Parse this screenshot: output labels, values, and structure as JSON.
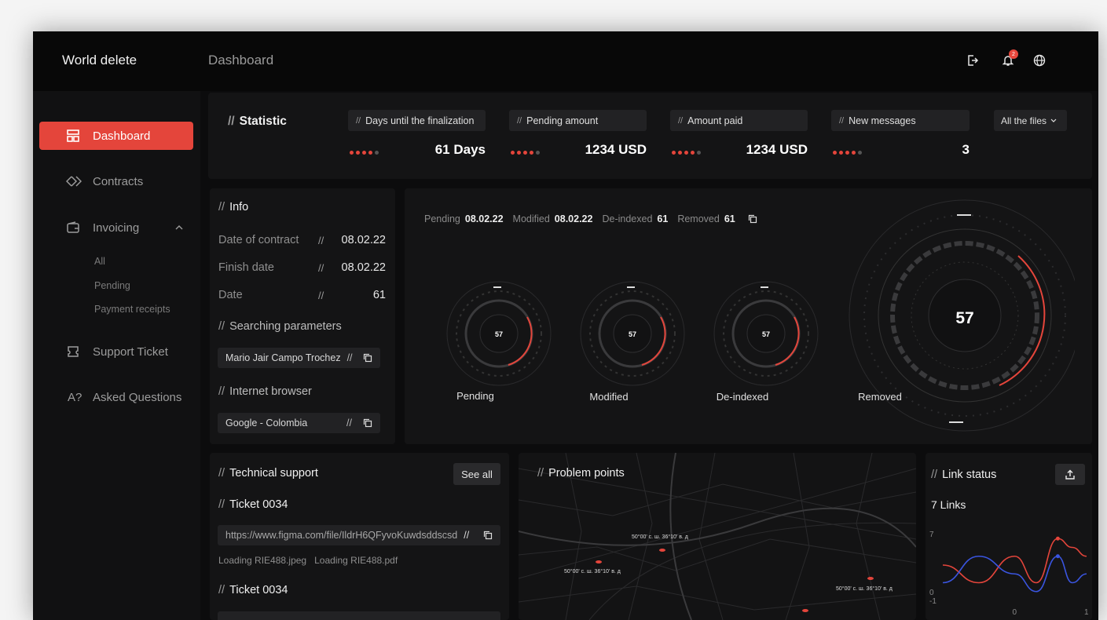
{
  "header": {
    "brand": "World delete",
    "page_title": "Dashboard",
    "notification_count": "2"
  },
  "sidebar": {
    "items": [
      {
        "label": "Dashboard",
        "icon": "dashboard-icon"
      },
      {
        "label": "Contracts",
        "icon": "contracts-icon"
      },
      {
        "label": "Invoicing",
        "icon": "wallet-icon"
      },
      {
        "label": "Support Ticket",
        "icon": "ticket-icon"
      },
      {
        "label": "Asked Questions",
        "icon": "question-icon"
      }
    ],
    "invoicing_sub": [
      "All",
      "Pending",
      "Payment receipts"
    ]
  },
  "statistic": {
    "title": "Statistic",
    "filter_label": "All the files",
    "cards": [
      {
        "label": "Days until the finalization",
        "value": "61 Days"
      },
      {
        "label": "Pending amount",
        "value": "1234 USD"
      },
      {
        "label": "Amount paid",
        "value": "1234 USD"
      },
      {
        "label": "New messages",
        "value": "3"
      }
    ]
  },
  "info": {
    "title": "Info",
    "rows": [
      {
        "label": "Date of contract",
        "value": "08.02.22"
      },
      {
        "label": "Finish date",
        "value": "08.02.22"
      },
      {
        "label": "Date",
        "value": "61"
      }
    ],
    "search_title": "Searching parameters",
    "search_value": "Mario Jair Campo Trochez",
    "browser_title": "Internet browser",
    "browser_value": "Google - Colombia"
  },
  "summary": {
    "pending_label": "Pending",
    "pending_value": "08.02.22",
    "modified_label": "Modified",
    "modified_value": "08.02.22",
    "deindexed_label": "De-indexed",
    "deindexed_value": "61",
    "removed_label": "Removed",
    "removed_value": "61"
  },
  "gauges": [
    {
      "label": "Pending",
      "value": "57"
    },
    {
      "label": "Modified",
      "value": "57"
    },
    {
      "label": "De-indexed",
      "value": "57"
    },
    {
      "label": "Removed",
      "value": "57"
    }
  ],
  "support": {
    "title": "Technical support",
    "see_all": "See all",
    "ticket1": "Ticket 0034",
    "url": "https://www.figma.com/file/IldrH6QFyvoKuwdsddscsd",
    "file1": "Loading RIE488.jpeg",
    "file2": "Loading RIE488.pdf",
    "ticket2": "Ticket 0034"
  },
  "map": {
    "title": "Problem points",
    "coords": [
      "50°00' с. ш. 36°10' в. д",
      "50°00' с. ш. 36°10' в. д",
      "50°00' с. ш. 36°10' в. д"
    ]
  },
  "links": {
    "title": "Link status",
    "count": "7 Links",
    "y_ticks": [
      "7",
      "0",
      "-1"
    ],
    "x_ticks": [
      "0",
      "1"
    ]
  },
  "chart_data": {
    "type": "line",
    "title": "Link status",
    "x": [
      -1.0,
      -0.5,
      0.0,
      0.3,
      0.6,
      0.8,
      1.0
    ],
    "ylim": [
      -1,
      7
    ],
    "series": [
      {
        "values": [
          3,
          1,
          4,
          1,
          6,
          5,
          4
        ],
        "color": "#e4453b"
      },
      {
        "values": [
          1,
          4,
          2,
          0,
          4,
          1,
          2
        ],
        "color": "#3a55e0"
      }
    ]
  }
}
